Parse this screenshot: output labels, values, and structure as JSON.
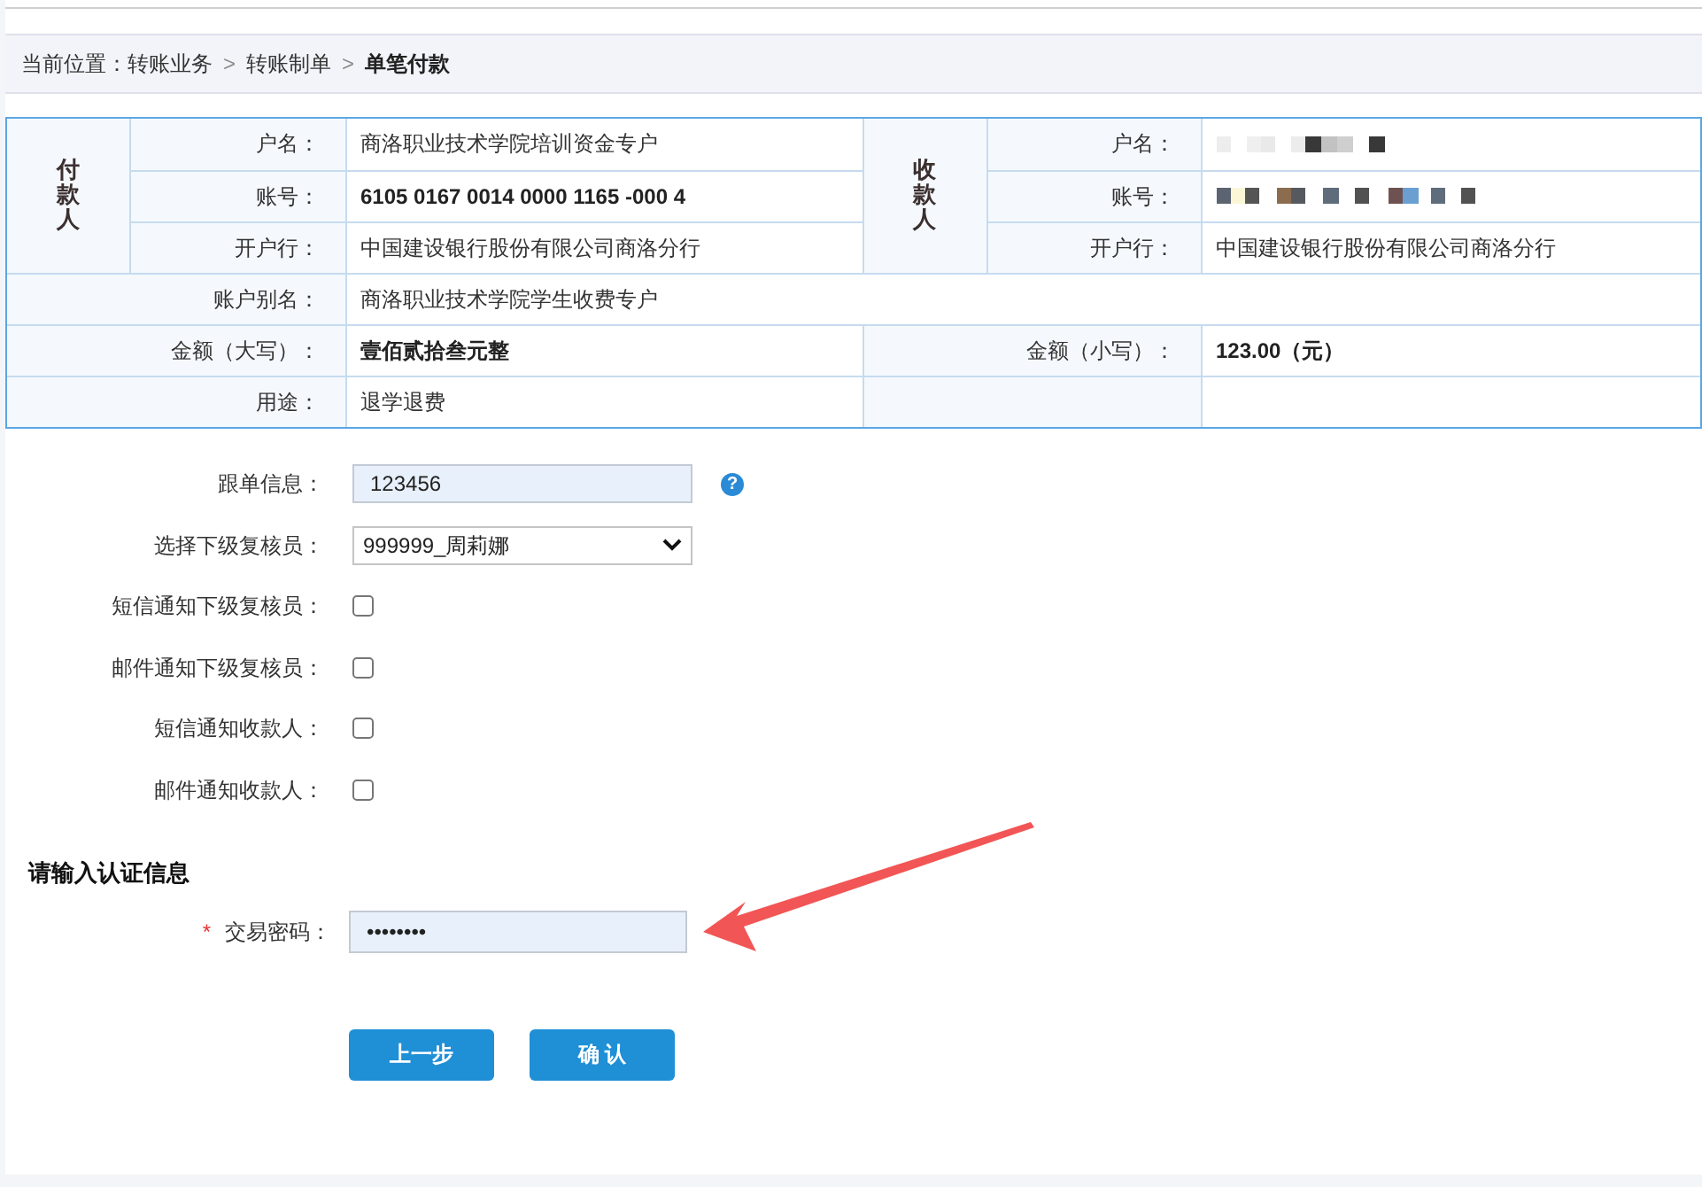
{
  "breadcrumb": {
    "prefix": "当前位置：",
    "items": [
      {
        "text": "转账业务",
        "current": false
      },
      {
        "text": "转账制单",
        "current": false
      },
      {
        "text": "单笔付款",
        "current": true
      }
    ],
    "separators": [
      ">",
      ">"
    ]
  },
  "parties": [
    {
      "header": "付款人",
      "fields": [
        {
          "label": "户名：",
          "kind": "text",
          "value": "商洛职业技术学院培训资金专户",
          "bold": false
        },
        {
          "label": "账号：",
          "kind": "text",
          "value": "6105 0167 0014 0000 1165 -000 4",
          "bold": true
        },
        {
          "label": "开户行：",
          "kind": "text",
          "value": "中国建设银行股份有限公司商洛分行",
          "bold": false
        }
      ]
    },
    {
      "header": "收款人",
      "fields": [
        {
          "label": "户名：",
          "kind": "redacted"
        },
        {
          "label": "账号：",
          "kind": "redacted"
        },
        {
          "label": "开户行：",
          "kind": "text",
          "value": "中国建设银行股份有限公司商洛分行",
          "bold": false
        }
      ]
    }
  ],
  "details": [
    {
      "kind": "wide",
      "cells": [
        {
          "label": "账户别名：",
          "value": "商洛职业技术学院学生收费专户",
          "bold": false
        }
      ]
    },
    {
      "kind": "pair",
      "cells": [
        {
          "label": "金额（大写）：",
          "value": "壹佰贰拾叁元整",
          "bold": true
        },
        {
          "label": "金额（小写）：",
          "value": "123.00（元）",
          "bold": true
        }
      ]
    },
    {
      "kind": "pair",
      "cells": [
        {
          "label": "用途：",
          "value": "退学退费",
          "bold": false
        }
      ]
    }
  ],
  "form": {
    "tracking": {
      "label": "跟单信息：",
      "value": "123456",
      "help_icon": "?"
    },
    "reviewer": {
      "label": "选择下级复核员：",
      "value": "999999_周莉娜"
    },
    "notifications": [
      {
        "label": "短信通知下级复核员：",
        "checked": false
      },
      {
        "label": "邮件通知下级复核员：",
        "checked": false
      },
      {
        "label": "短信通知收款人：",
        "checked": false
      },
      {
        "label": "邮件通知收款人：",
        "checked": false
      }
    ]
  },
  "auth": {
    "title": "请输入认证信息",
    "password": {
      "required_mark": "*",
      "label": "交易密码：",
      "value": "••••••••"
    }
  },
  "buttons": [
    {
      "label": "上一步"
    },
    {
      "label": "确 认"
    }
  ],
  "annotation": {
    "kind": "arrow"
  }
}
